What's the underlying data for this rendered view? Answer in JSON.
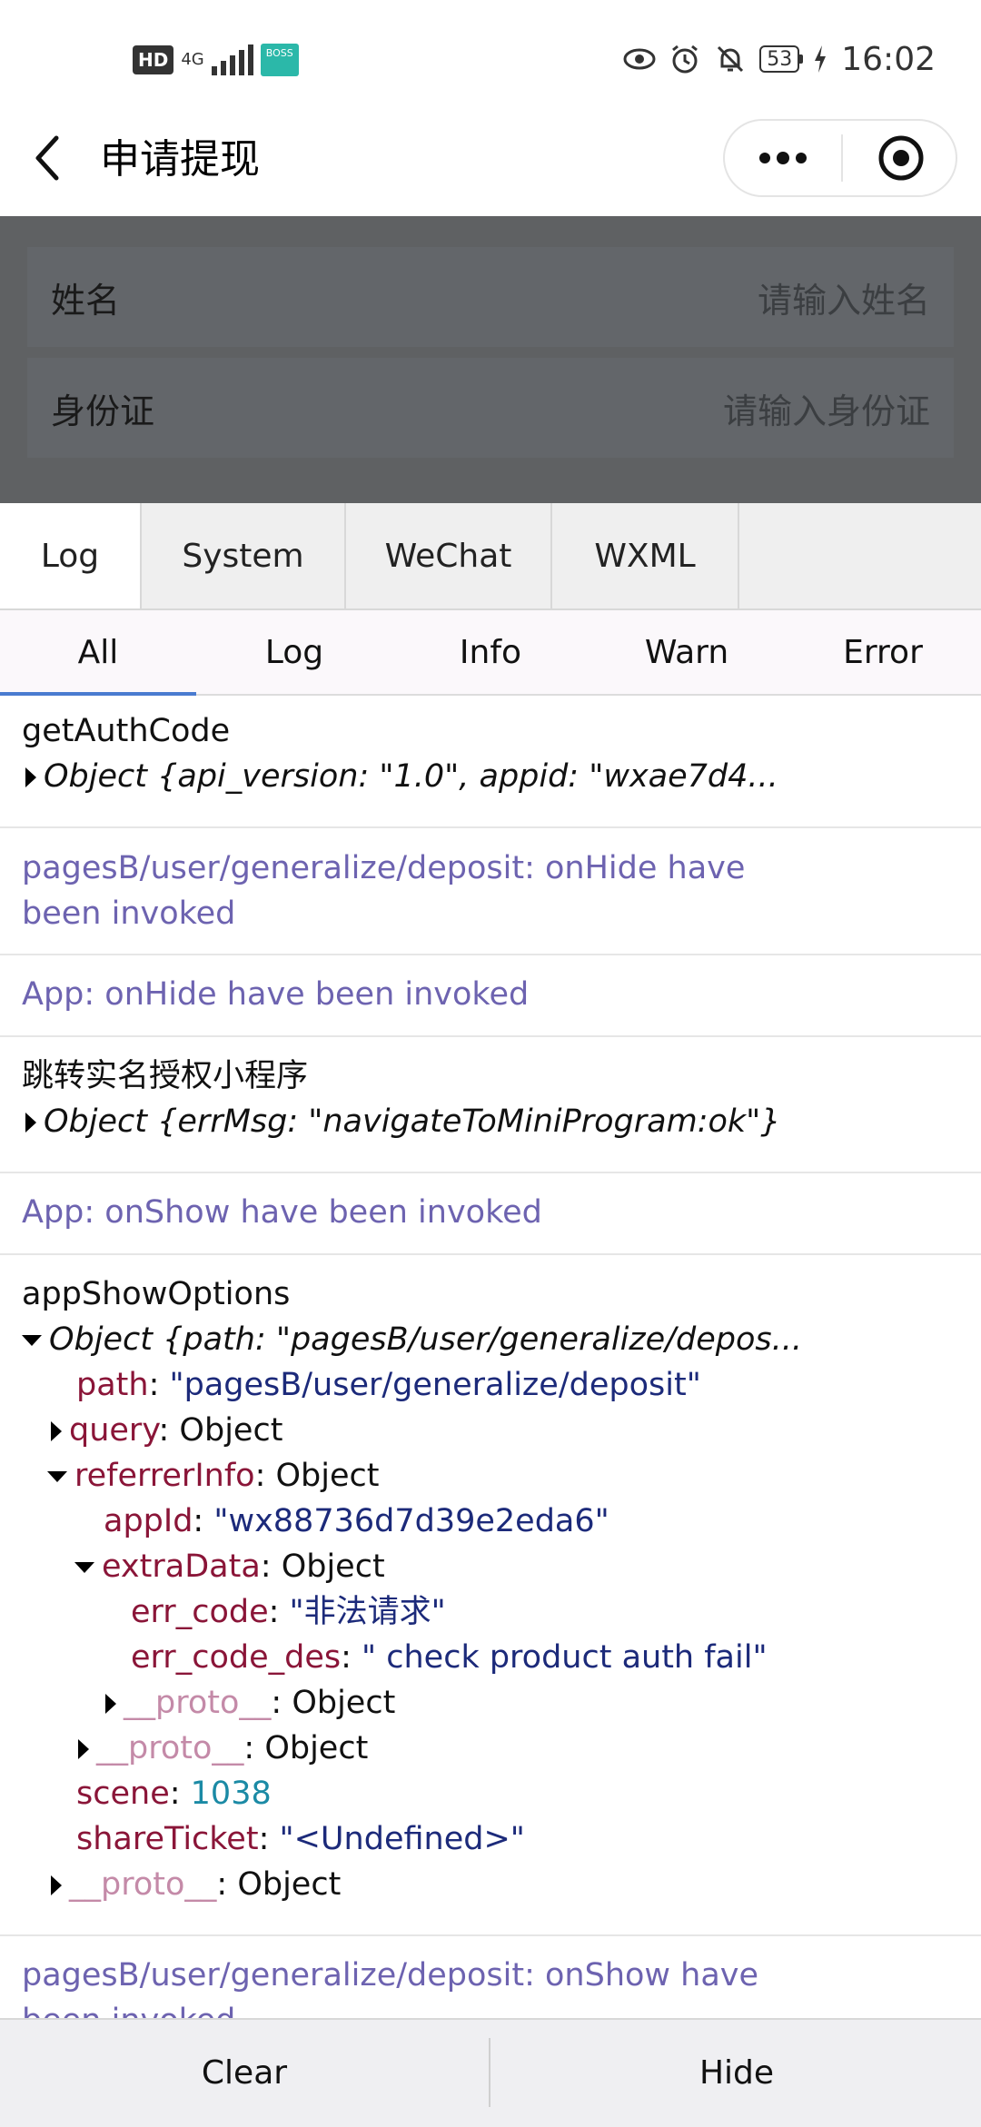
{
  "status_bar": {
    "hd": "HD",
    "network": "4G",
    "app_badge": "BOSS",
    "battery": "53",
    "time": "16:02"
  },
  "nav": {
    "title": "申请提现"
  },
  "form": {
    "name_label": "姓名",
    "name_placeholder": "请输入姓名",
    "id_label": "身份证",
    "id_placeholder": "请输入身份证"
  },
  "tabs": [
    "Log",
    "System",
    "WeChat",
    "WXML"
  ],
  "filters": [
    "All",
    "Log",
    "Info",
    "Warn",
    "Error"
  ],
  "logs": {
    "e1_title": "getAuthCode",
    "e1_obj": "Object {api_version: \"1.0\", appid: \"wxae7d4...",
    "e2_line1": "pagesB/user/generalize/deposit: onHide have",
    "e2_line2": "been invoked",
    "e3": "App: onHide have been invoked",
    "e4_title": "跳转实名授权小程序",
    "e4_obj": "Object {errMsg: \"navigateToMiniProgram:ok\"}",
    "e5": "App: onShow have been invoked",
    "e6_title": "appShowOptions",
    "e6_obj": "Object {path: \"pagesB/user/generalize/depos...",
    "path_key": "path",
    "path_val": "\"pagesB/user/generalize/deposit\"",
    "query_key": "query",
    "object_word": "Object",
    "referrer_key": "referrerInfo",
    "appid_key": "appId",
    "appid_val": "\"wx88736d7d39e2eda6\"",
    "extra_key": "extraData",
    "err_code_key": "err_code",
    "err_code_val": "\"非法请求\"",
    "err_des_key": "err_code_des",
    "err_des_val": "\" check product auth fail\"",
    "proto_key": "__proto__",
    "scene_key": "scene",
    "scene_val": "1038",
    "share_key": "shareTicket",
    "share_val": "\"<Undefined>\"",
    "e7_line1": "pagesB/user/generalize/deposit: onShow have",
    "e7_line2": "been invoked"
  },
  "bottom": {
    "clear": "Clear",
    "hide": "Hide"
  },
  "colors": {
    "accent_underline": "#4a7bd0",
    "log_purple": "#6d63b0",
    "key": "#8a1538",
    "string": "#1c2a7a",
    "number": "#1b8aa5"
  }
}
